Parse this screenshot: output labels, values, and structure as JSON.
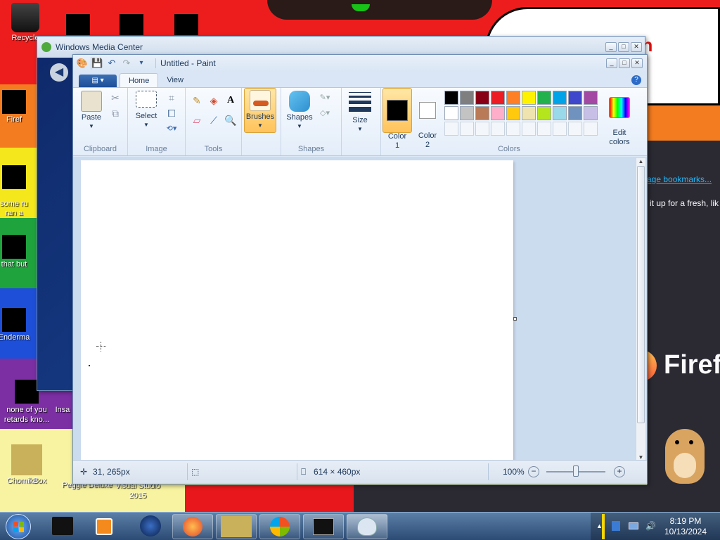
{
  "desktop": {
    "icons": [
      {
        "name": "recycle-bin",
        "label": "Recycle"
      },
      {
        "name": "firefox",
        "label": "Firef"
      },
      {
        "name": "some-ru",
        "label": "some ru\nran a"
      },
      {
        "name": "that-but",
        "label": "that but"
      },
      {
        "name": "enderman",
        "label": "Enderma"
      },
      {
        "name": "none-of-you",
        "label": "none of you retards kno..."
      },
      {
        "name": "insane",
        "label": "Insa"
      },
      {
        "name": "chomikbox",
        "label": "ChomikBox"
      },
      {
        "name": "peggle",
        "label": "Peggle Deluxe"
      },
      {
        "name": "visual-studio",
        "label": "Visual Studio 2015"
      }
    ],
    "bubble_text": "nth",
    "browser_link": "age bookmarks...",
    "browser_text": "it up for a fresh, lik",
    "firefox_brand": "Firef"
  },
  "wmc": {
    "title": "Windows Media Center"
  },
  "paint": {
    "title": "Untitled - Paint",
    "tabs": {
      "home": "Home",
      "view": "View"
    },
    "groups": {
      "clipboard": "Clipboard",
      "image": "Image",
      "tools": "Tools",
      "shapes": "Shapes",
      "colors": "Colors"
    },
    "buttons": {
      "paste": "Paste",
      "select": "Select",
      "brushes": "Brushes",
      "shapes": "Shapes",
      "size": "Size",
      "color1": "Color\n1",
      "color2": "Color\n2",
      "edit_colors": "Edit\ncolors"
    },
    "palette_row1": [
      "#000000",
      "#7f7f7f",
      "#880015",
      "#ed1c24",
      "#ff7f27",
      "#fff200",
      "#22b14c",
      "#00a2e8",
      "#3f48cc",
      "#a349a4"
    ],
    "palette_row2": [
      "#ffffff",
      "#c3c3c3",
      "#b97a57",
      "#ffaec9",
      "#ffc90e",
      "#efe4b0",
      "#b5e61d",
      "#99d9ea",
      "#7092be",
      "#c8bfe7"
    ],
    "color1": "#000000",
    "color2": "#ffffff",
    "status": {
      "cursor": "31, 265px",
      "size": "614 × 460px",
      "zoom": "100%"
    }
  },
  "taskbar": {
    "time": "8:19 PM",
    "date": "10/13/2024"
  }
}
